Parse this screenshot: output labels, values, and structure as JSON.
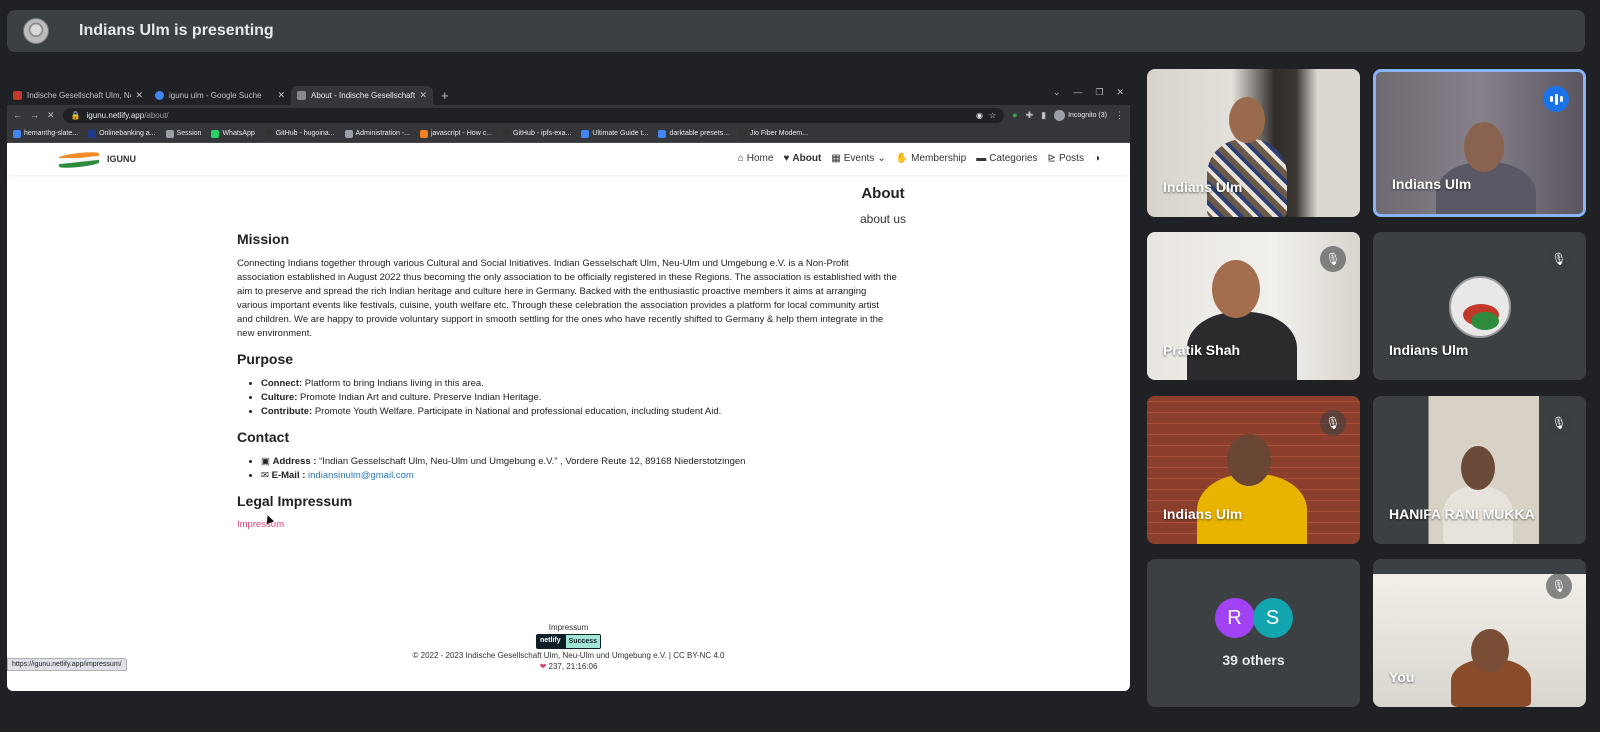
{
  "banner": {
    "title": "Indians Ulm is presenting"
  },
  "browser": {
    "tabs": [
      {
        "label": "Indische Gesellschaft Ulm, Ne...",
        "active": false,
        "favicon_color": "#c0392b"
      },
      {
        "label": "igunu ulm - Google Suche",
        "active": false,
        "favicon_color": "#4285f4"
      },
      {
        "label": "About - Indische Gesellschaft...",
        "active": true,
        "favicon_color": "#888888"
      }
    ],
    "url": {
      "host": "igunu.netlify.app",
      "path": "/about/"
    },
    "incognito_label": "Incognito (3)",
    "bookmarks": [
      {
        "label": "hemanthg-slate...",
        "color": "#4285f4"
      },
      {
        "label": "Onlinebanking a...",
        "color": "#1e3a8a"
      },
      {
        "label": "Session",
        "color": "#9aa0a6"
      },
      {
        "label": "WhatsApp",
        "color": "#25d366"
      },
      {
        "label": "GitHub - hugoina...",
        "color": "#333333"
      },
      {
        "label": "Administration -...",
        "color": "#9aa0a6"
      },
      {
        "label": "javascript - How c...",
        "color": "#f48024"
      },
      {
        "label": "GitHub - ipfs-exa...",
        "color": "#333333"
      },
      {
        "label": "Ultimate Guide t...",
        "color": "#4285f4"
      },
      {
        "label": "darktable presets...",
        "color": "#4285f4"
      },
      {
        "label": "Jio Fiber Modem...",
        "color": "#333333"
      }
    ],
    "status_url": "https://igunu.netlify.app/impressum/"
  },
  "site": {
    "brand": "IGUNU",
    "nav": [
      "Home",
      "About",
      "Events",
      "Membership",
      "Categories",
      "Posts"
    ],
    "about_heading": "About",
    "about_sub": "about us",
    "mission": {
      "heading": "Mission",
      "text": "Connecting Indians together through various Cultural and Social Initiatives. Indian Gesselschaft Ulm, Neu-Ulm und Umgebung e.V. is a Non-Profit association established in August 2022 thus becoming the only association to be officially registered in these Regions. The association is established with the aim to preserve and spread the rich Indian heritage and culture here in Germany. Backed with the enthusiastic proactive members it aims at arranging various important events like festivals, cuisine, youth welfare etc. Through these celebration the association provides a platform for local community artist and children. We are happy to provide voluntary support in smooth settling for the ones who have recently shifted to Germany & help them integrate in the new environment."
    },
    "purpose": {
      "heading": "Purpose",
      "items": [
        {
          "label": "Connect:",
          "text": " Platform to bring Indians living in this area."
        },
        {
          "label": "Culture:",
          "text": " Promote Indian Art and culture. Preserve Indian Heritage."
        },
        {
          "label": "Contribute:",
          "text": " Promote Youth Welfare. Participate in National and professional education, including student Aid."
        }
      ]
    },
    "contact": {
      "heading": "Contact",
      "address_label": "Address :",
      "address": " “Indian Gesselschaft Ulm, Neu-Ulm und Umgebung e.V.” , Vordere Reute 12, 89168 Niederstotzingen",
      "email_label": "E-Mail :",
      "email": "indiansinulm@gmail.com"
    },
    "legal": {
      "heading": "Legal Impressum",
      "link": "Impressum"
    },
    "footer": {
      "impressum": "Impressum",
      "badge_left": "netlify",
      "badge_right": "Success",
      "copyright": "© 2022 - 2023 Indische Gesellschaft Ulm, Neu-Ulm und Umgebung e.V. | CC BY-NC 4.0",
      "stats": "237, 21:16:06"
    }
  },
  "participants": [
    {
      "name": "Indians Ulm",
      "muted": false,
      "speaking": false,
      "active": false
    },
    {
      "name": "Indians Ulm",
      "muted": false,
      "speaking": true,
      "active": true
    },
    {
      "name": "Pratik Shah",
      "muted": true,
      "speaking": false,
      "active": false
    },
    {
      "name": "Indians Ulm",
      "muted": true,
      "speaking": false,
      "active": false
    },
    {
      "name": "Indians Ulm",
      "muted": true,
      "speaking": false,
      "active": false
    },
    {
      "name": "HANIFA RANI MUKKA",
      "muted": true,
      "speaking": false,
      "active": false
    },
    {
      "name": "You",
      "muted": true,
      "speaking": false,
      "active": false
    }
  ],
  "others": {
    "initials": [
      "R",
      "S"
    ],
    "colors": [
      "#a142f4",
      "#12a4af"
    ],
    "label": "39 others"
  }
}
